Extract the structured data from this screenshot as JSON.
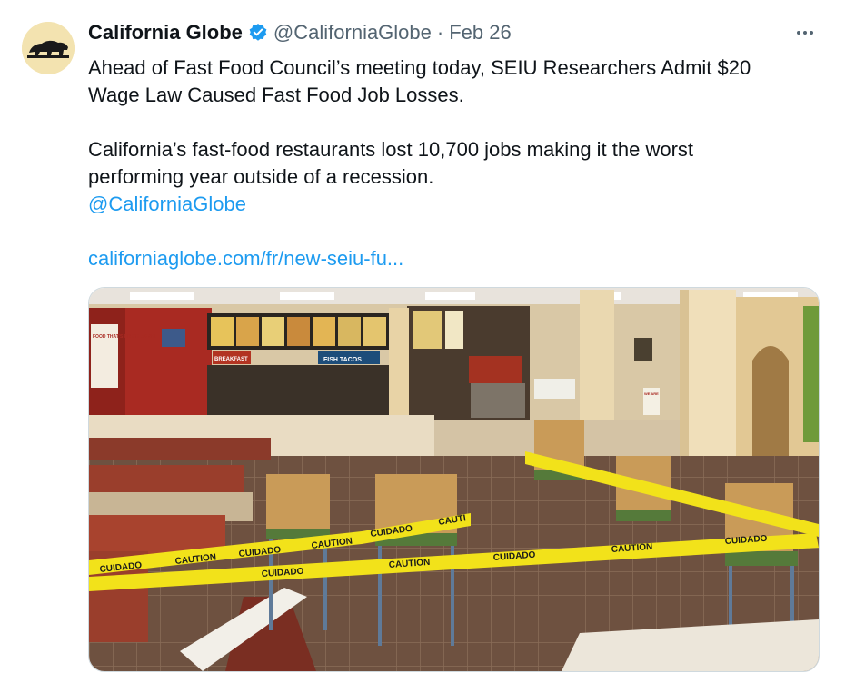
{
  "tweet": {
    "author_name": "California Globe",
    "handle": "@CaliforniaGlobe",
    "separator": "·",
    "date": "Feb 26",
    "text_line_1": "Ahead of Fast Food Council’s meeting today, SEIU Researchers Admit $20",
    "text_line_2": "Wage Law Caused Fast Food Job Losses.",
    "text_line_3": "California’s fast-food restaurants lost 10,700 jobs making it the worst",
    "text_line_4": "performing year outside of a recession.",
    "mention": "@CaliforniaGlobe",
    "url": "californiaglobe.com/fr/new-seiu-fu..."
  },
  "icons": {
    "avatar": "california-bear-logo",
    "verified": "verified-badge-icon",
    "more": "more-options-icon"
  },
  "media": {
    "signs": {
      "fish_tacos": "FISH TACOS",
      "breakfast": "BREAKFAST",
      "food_sign": "FOOD THAT'S FRESH AS SEL",
      "we_are_hiring": "WE ARE"
    },
    "tape_words": [
      "CUIDADO",
      "CAUTION",
      "CUIDADO",
      "CAUTION",
      "CUIDADO",
      "CAUTI"
    ],
    "tape_words_2": [
      "CUIDADO",
      "CAUTION",
      "CUIDADO",
      "CAUTION",
      "CUIDADO"
    ]
  },
  "colors": {
    "link": "#1d9bf0",
    "secondary_text": "#536471",
    "verified": "#1d9bf0",
    "tape": "#f2e21a"
  }
}
